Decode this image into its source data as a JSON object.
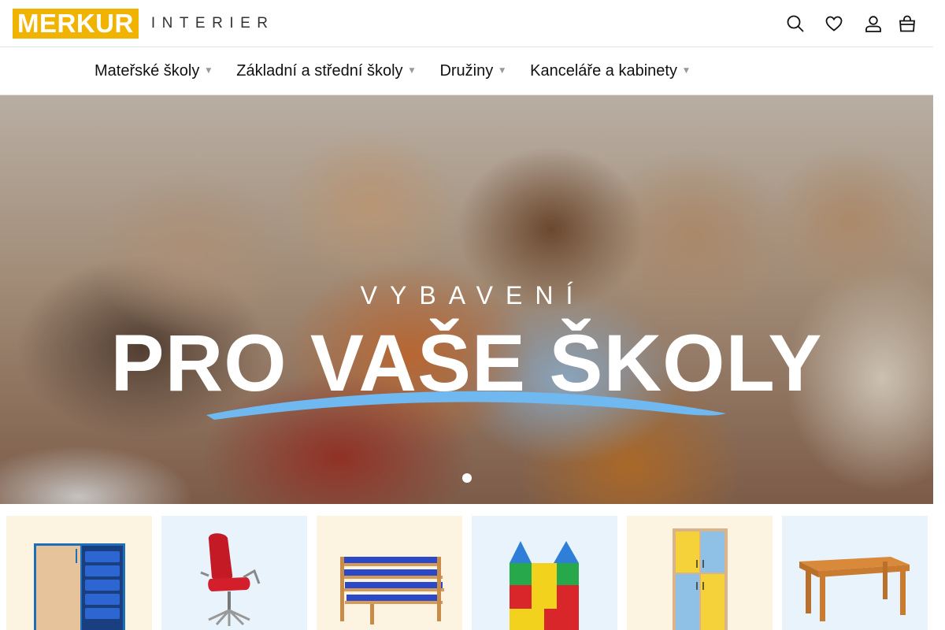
{
  "brand": {
    "name": "MERKUR",
    "sub": "INTERIER",
    "accent": "#f0b400"
  },
  "header_icons": [
    "search-icon",
    "heart-icon",
    "user-icon",
    "shopping-bag-icon"
  ],
  "nav": {
    "items": [
      {
        "label": "Mateřské školy"
      },
      {
        "label": "Základní a střední školy"
      },
      {
        "label": "Družiny"
      },
      {
        "label": "Kanceláře a kabinety"
      }
    ]
  },
  "hero": {
    "subtitle": "VYBAVENÍ",
    "title": "PRO VAŠE ŠKOLY",
    "swoosh_color": "#6fb8f0",
    "slides_shown": 1
  },
  "categories": {
    "tiles": [
      {
        "icon": "storage-cabinet-icon",
        "bg": "#fdf3e1"
      },
      {
        "icon": "office-chair-icon",
        "bg": "#e9f3fb"
      },
      {
        "icon": "stacking-beds-icon",
        "bg": "#fdf3e1"
      },
      {
        "icon": "foam-blocks-icon",
        "bg": "#e9f3fb"
      },
      {
        "icon": "wardrobe-icon",
        "bg": "#fdf3e1"
      },
      {
        "icon": "table-icon",
        "bg": "#e9f3fb"
      }
    ]
  }
}
